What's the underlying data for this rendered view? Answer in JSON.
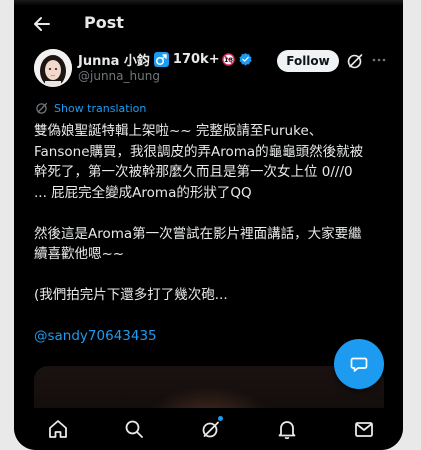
{
  "header": {
    "title": "Post",
    "back_icon": "arrow-left-icon"
  },
  "author": {
    "display_name": "Junna 小鈞",
    "gender_icon": "male-sign-icon",
    "follower_count": "170k+",
    "age_badge_icon": "no-under-18-icon",
    "verified_icon": "verified-badge-icon",
    "verified_color": "#1d9bf0",
    "handle": "@junna_hung",
    "follow_label": "Follow"
  },
  "translation": {
    "label": "Show translation",
    "icon": "translate-icon",
    "color": "#1d9bf0"
  },
  "post": {
    "lines": [
      "雙偽娘聖誕特輯上架啦~~ 完整版請至Furuke、",
      "Fansone購買，我很調皮的弄Aroma的龜龜頭然後就被",
      "幹死了，第一次被幹那麼久而且是第一次女上位 0///0",
      "... 屁屁完全變成Aroma的形狀了QQ",
      "",
      "然後這是Aroma第一次嘗試在影片裡面講話，大家要繼",
      "續喜歡他嗯~~",
      "",
      "(我們拍完片下還多打了幾次砲..."
    ],
    "mention": "@sandy70643435"
  },
  "fab": {
    "icon": "compose-post-icon"
  },
  "bottom_nav": {
    "items": [
      "home-icon",
      "search-icon",
      "grok-icon",
      "notifications-icon",
      "messages-icon"
    ],
    "active_dot_color": "#1d9bf0"
  },
  "colors": {
    "background": "#000000",
    "text": "#e7e9ea",
    "muted": "#71767b",
    "accent": "#1d9bf0"
  }
}
